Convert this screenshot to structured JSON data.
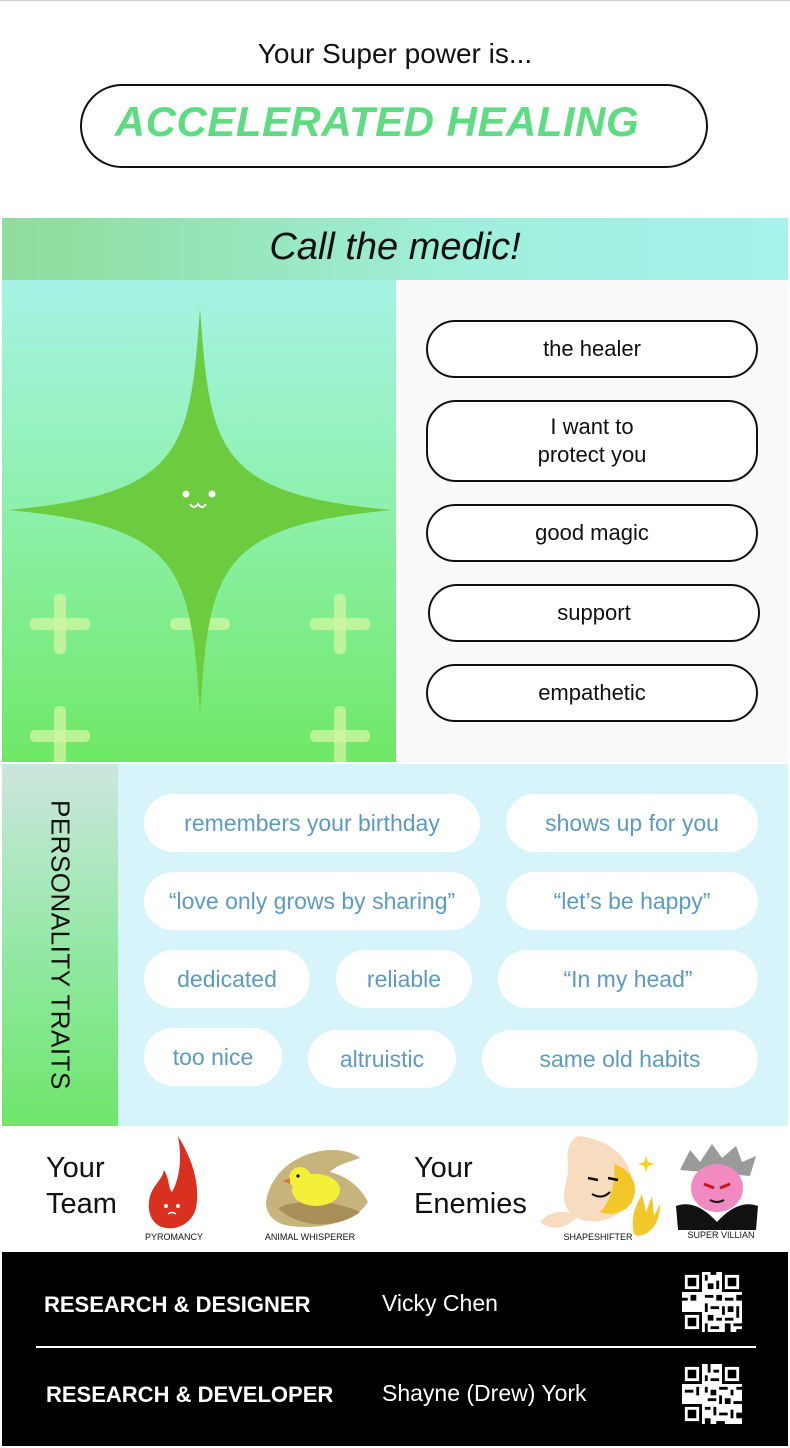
{
  "header": {
    "heading": "Your Super power is...",
    "power": "ACCELERATED HEALING"
  },
  "banner": {
    "text": "Call the medic!"
  },
  "tags": [
    "the healer",
    "I want to\nprotect you",
    "good magic",
    "support",
    "empathetic"
  ],
  "traits": {
    "label": "PERSONALITY TRAITS",
    "chips": [
      "remembers your birthday",
      "shows up for you",
      "“love only grows by sharing”",
      "“let’s be happy”",
      "dedicated",
      "reliable",
      "“In my head”",
      "too nice",
      "altruistic",
      "same old habits"
    ]
  },
  "team": {
    "label_line1": "Your",
    "label_line2": "Team",
    "members": [
      "PYROMANCY",
      "ANIMAL WHISPERER"
    ]
  },
  "enemies": {
    "label_line1": "Your",
    "label_line2": "Enemies",
    "members": [
      "SHAPESHIFTER",
      "SUPER VILLIAN"
    ]
  },
  "credits": [
    {
      "role": "RESEARCH & DESIGNER",
      "name": "Vicky Chen"
    },
    {
      "role": "RESEARCH & DEVELOPER",
      "name": "Shayne (Drew) York"
    }
  ],
  "colors": {
    "accent_green": "#5edc82",
    "chip_text": "#5d9ac2",
    "traits_bg": "#d6f4fa"
  }
}
